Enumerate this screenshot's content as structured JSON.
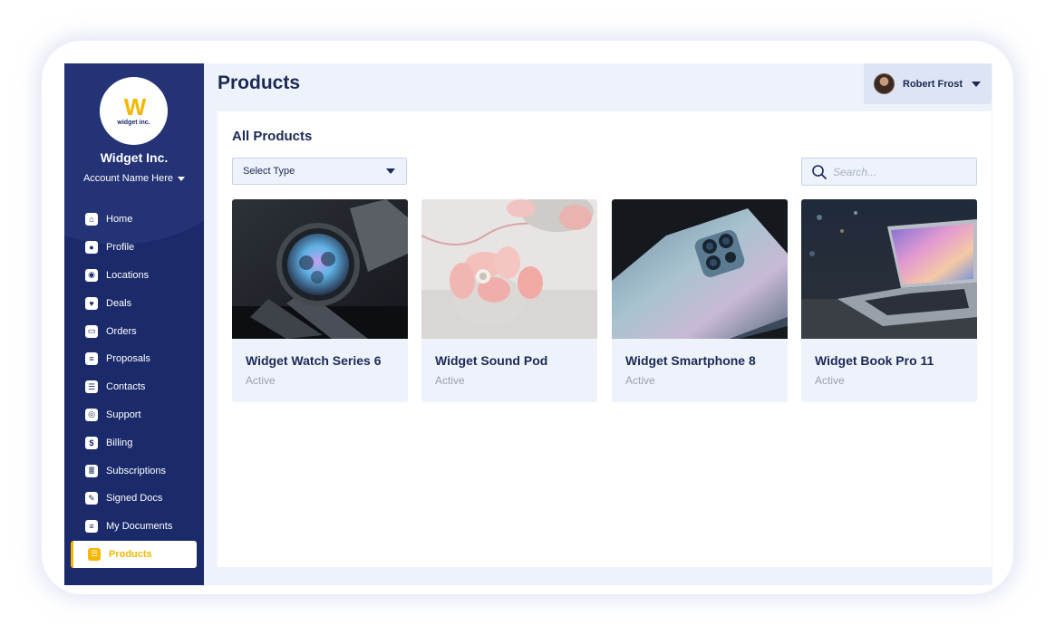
{
  "brand": {
    "logo_text": "widget inc.",
    "company_name": "Widget Inc.",
    "account_name": "Account Name Here",
    "accent_color": "#f5b700",
    "sidebar_color": "#1b2a6b"
  },
  "sidebar": {
    "items": [
      {
        "label": "Home",
        "icon": "home-icon"
      },
      {
        "label": "Profile",
        "icon": "profile-icon"
      },
      {
        "label": "Locations",
        "icon": "location-pin-icon"
      },
      {
        "label": "Deals",
        "icon": "handshake-icon"
      },
      {
        "label": "Orders",
        "icon": "orders-icon"
      },
      {
        "label": "Proposals",
        "icon": "document-icon"
      },
      {
        "label": "Contacts",
        "icon": "contacts-list-icon"
      },
      {
        "label": "Support",
        "icon": "support-icon"
      },
      {
        "label": "Billing",
        "icon": "dollar-icon"
      },
      {
        "label": "Subscriptions",
        "icon": "subscriptions-icon"
      },
      {
        "label": "Signed Docs",
        "icon": "signed-doc-icon"
      },
      {
        "label": "My Documents",
        "icon": "my-documents-icon"
      },
      {
        "label": "Products",
        "icon": "products-icon",
        "active": true
      }
    ]
  },
  "header": {
    "title": "Products",
    "user_name": "Robert Frost"
  },
  "main": {
    "section_title": "All Products",
    "select_type_label": "Select Type",
    "search_placeholder": "Search...",
    "products": [
      {
        "name": "Widget Watch Series 6",
        "status": "Active"
      },
      {
        "name": "Widget Sound Pod",
        "status": "Active"
      },
      {
        "name": "Widget Smartphone 8",
        "status": "Active"
      },
      {
        "name": "Widget Book Pro 11",
        "status": "Active"
      }
    ]
  }
}
